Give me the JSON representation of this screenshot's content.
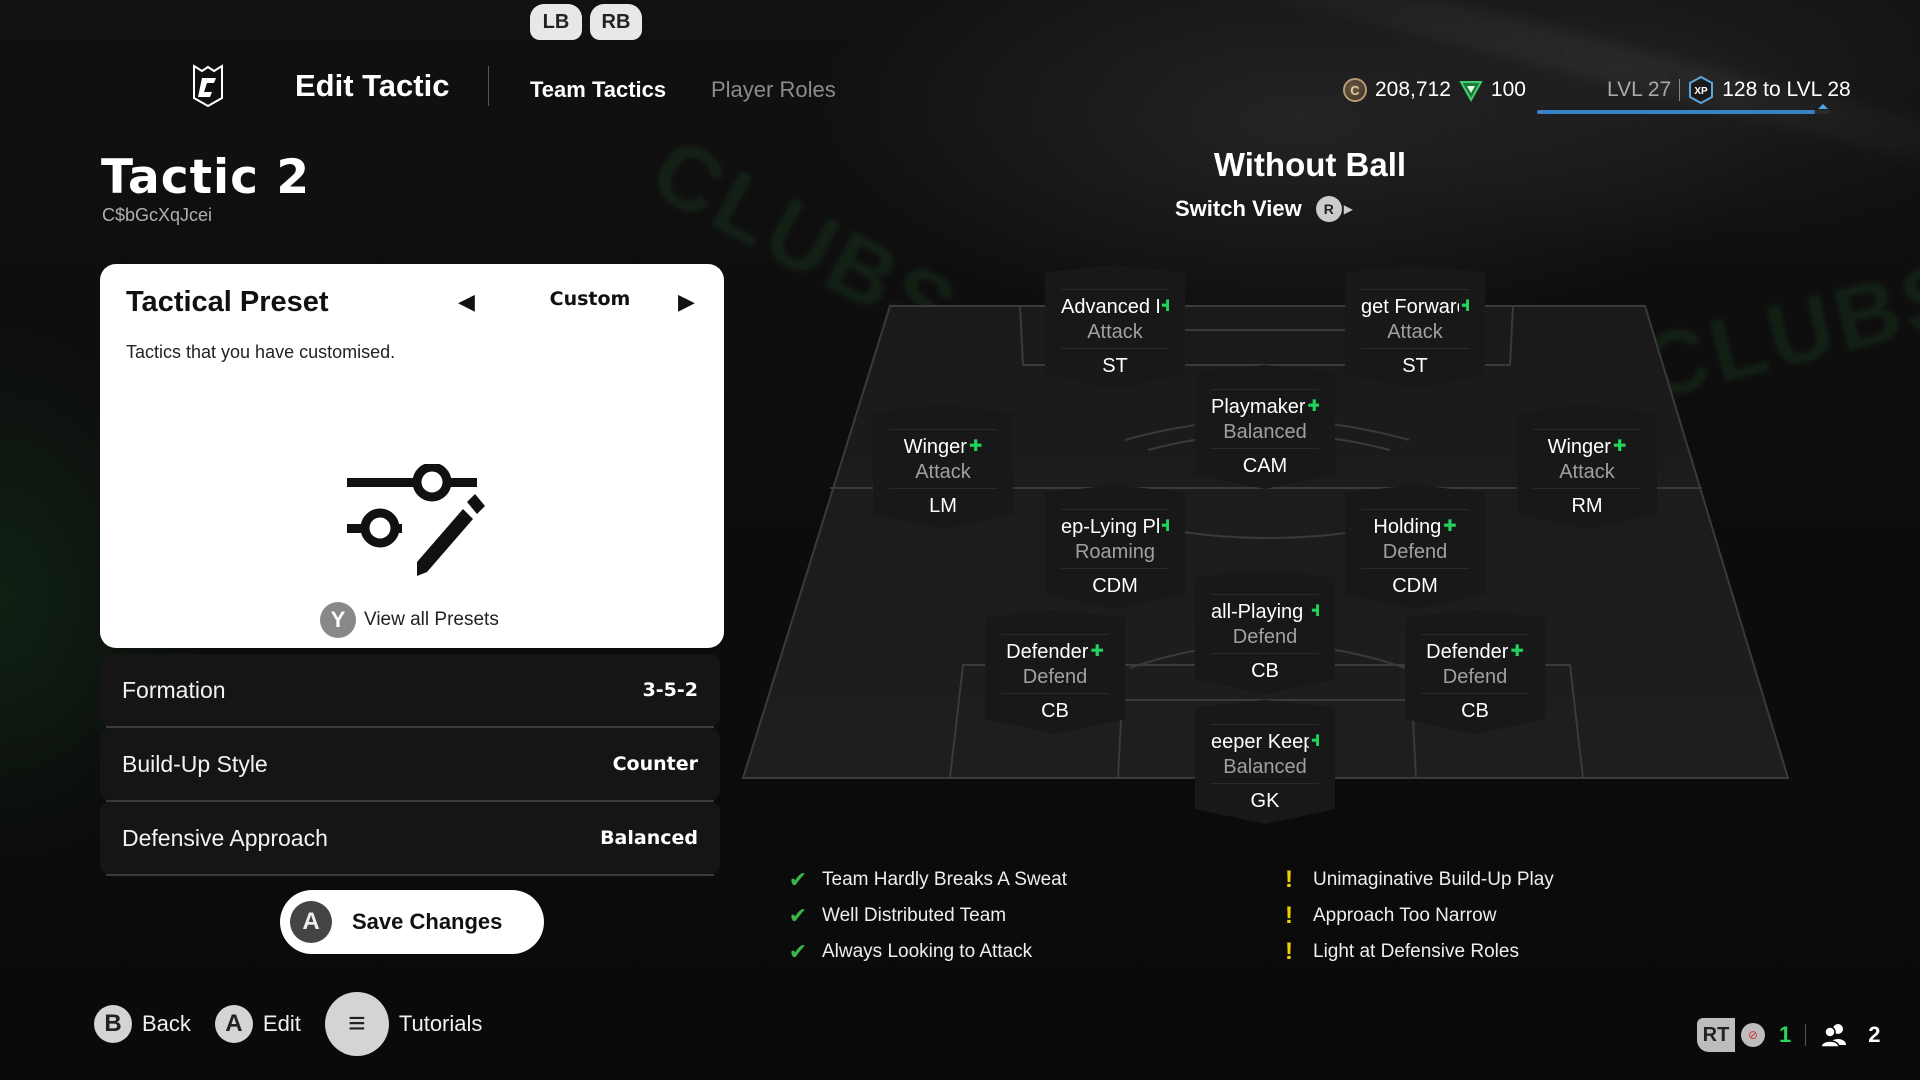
{
  "header": {
    "bumpers": [
      "LB",
      "RB"
    ],
    "title": "Edit Tactic",
    "tabs": [
      {
        "label": "Team Tactics",
        "active": true
      },
      {
        "label": "Player Roles",
        "active": false
      }
    ],
    "coins": "208,712",
    "points": "100",
    "level_current": "LVL 27",
    "xp_badge": "XP",
    "level_next": "128 to LVL 28",
    "xp_progress_percent": 95
  },
  "tactic": {
    "name": "Tactic 2",
    "code": "C$bGcXqJcei"
  },
  "preset": {
    "title": "Tactical Preset",
    "value": "Custom",
    "description": "Tactics that you have customised.",
    "view_all_button": "Y",
    "view_all_label": "View all Presets",
    "icon": "sliders-edit-icon"
  },
  "settings": [
    {
      "label": "Formation",
      "value": "3-5-2"
    },
    {
      "label": "Build-Up Style",
      "value": "Counter"
    },
    {
      "label": "Defensive Approach",
      "value": "Balanced"
    }
  ],
  "save": {
    "button": "A",
    "label": "Save Changes"
  },
  "footer": [
    {
      "button": "B",
      "label": "Back"
    },
    {
      "button": "A",
      "label": "Edit"
    },
    {
      "button": "≡",
      "label": "Tutorials"
    }
  ],
  "status": {
    "rt": "RT",
    "mic_count": "1",
    "party_count": "2"
  },
  "pitch_view": {
    "title": "Without Ball",
    "switch_label": "Switch View",
    "switch_button": "R"
  },
  "players": [
    {
      "role": "Advanced Forward",
      "focus": "Attack",
      "position": "ST"
    },
    {
      "role": "Target Forward",
      "focus": "Attack",
      "position": "ST"
    },
    {
      "role": "Playmaker",
      "focus": "Balanced",
      "position": "CAM"
    },
    {
      "role": "Winger",
      "focus": "Attack",
      "position": "LM"
    },
    {
      "role": "Winger",
      "focus": "Attack",
      "position": "RM"
    },
    {
      "role": "Deep-Lying Playmaker",
      "focus": "Roaming",
      "position": "CDM"
    },
    {
      "role": "Holding",
      "focus": "Defend",
      "position": "CDM"
    },
    {
      "role": "Ball-Playing Defender",
      "focus": "Defend",
      "position": "CB"
    },
    {
      "role": "Defender",
      "focus": "Defend",
      "position": "CB"
    },
    {
      "role": "Defender",
      "focus": "Defend",
      "position": "CB"
    },
    {
      "role": "Sweeper Keeper",
      "focus": "Balanced",
      "position": "GK"
    }
  ],
  "player_display": [
    "Advanced F­",
    "get Forward",
    "Playmaker",
    "Winger",
    "Winger",
    "ep-Lying Play",
    "Holding",
    "all-Playing De",
    "Defender",
    "Defender",
    "eeper Keepe"
  ],
  "strengths": [
    "Team Hardly Breaks A Sweat",
    "Well Distributed Team",
    "Always Looking to Attack"
  ],
  "weaknesses": [
    "Unimaginative Build-Up Play",
    "Approach Too Narrow",
    "Light at Defensive Roles"
  ],
  "colors": {
    "accent_green": "#22d35c",
    "check_green": "#39b54a",
    "warning_yellow": "#f0d000",
    "xp_blue": "#3b82c4"
  }
}
